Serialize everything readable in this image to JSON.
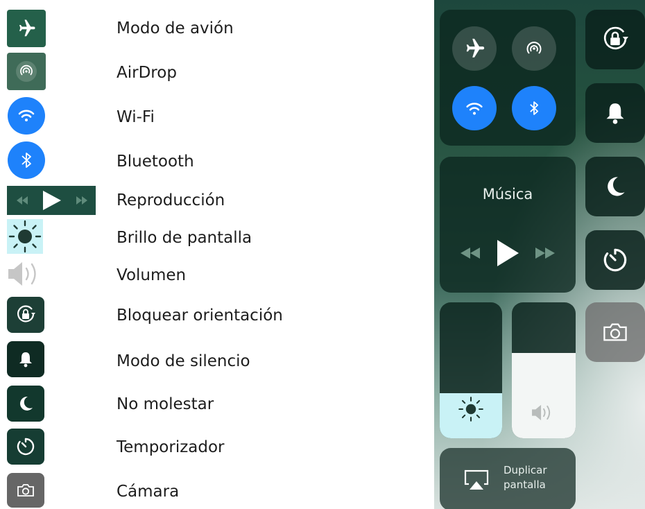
{
  "legend": {
    "items": [
      {
        "icon": "airplane-icon",
        "label": "Modo de avión"
      },
      {
        "icon": "airdrop-icon",
        "label": "AirDrop"
      },
      {
        "icon": "wifi-icon",
        "label": "Wi-Fi"
      },
      {
        "icon": "bluetooth-icon",
        "label": "Bluetooth"
      },
      {
        "icon": "playback-icon",
        "label": "Reproducción"
      },
      {
        "icon": "brightness-icon",
        "label": "Brillo de pantalla"
      },
      {
        "icon": "volume-icon",
        "label": "Volumen"
      },
      {
        "icon": "orientation-lock-icon",
        "label": "Bloquear orientación"
      },
      {
        "icon": "bell-icon",
        "label": "Modo de silencio"
      },
      {
        "icon": "moon-icon",
        "label": "No molestar"
      },
      {
        "icon": "timer-icon",
        "label": "Temporizador"
      },
      {
        "icon": "camera-icon",
        "label": "Cámara"
      }
    ]
  },
  "control_center": {
    "music": {
      "title": "Música"
    },
    "screen_mirroring": {
      "line1": "Duplicar",
      "line2": "pantalla"
    },
    "brightness_level": 0.33,
    "volume_level": 0.63,
    "wifi_on": true,
    "bluetooth_on": true,
    "airplane_on": false
  },
  "colors": {
    "active_blue": "#1e82fb",
    "dark_tile": "#0c261f",
    "brightness_fill": "#c9f2f6",
    "volume_fill": "#f3f6f5"
  }
}
